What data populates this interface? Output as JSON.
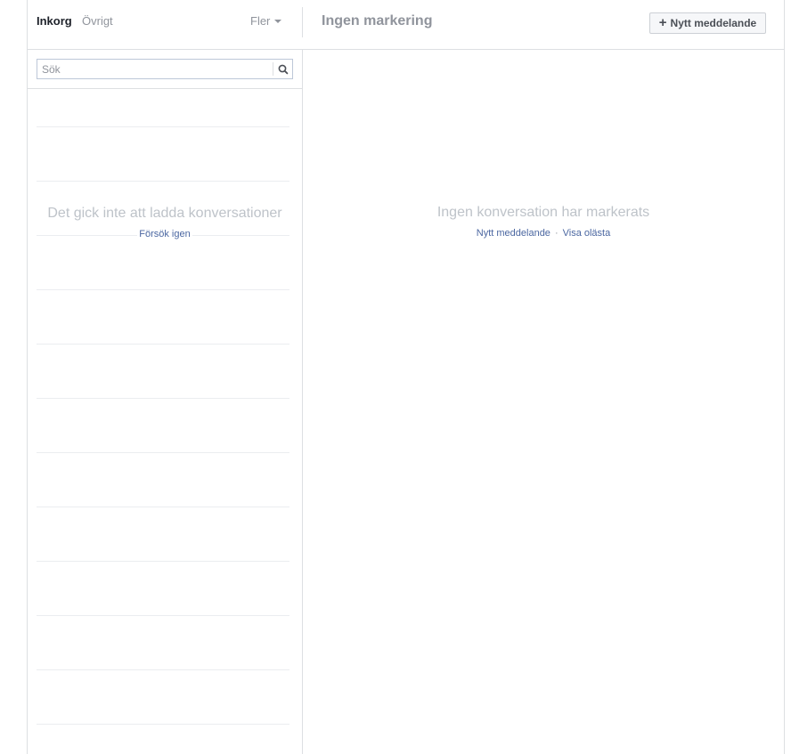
{
  "header": {
    "tabs": [
      {
        "label": "Inkorg",
        "active": true
      },
      {
        "label": "Övrigt",
        "active": false
      }
    ],
    "more_label": "Fler",
    "thread_title": "Ingen markering",
    "new_message_button": {
      "icon": "plus-icon",
      "label": "Nytt meddelande"
    }
  },
  "search": {
    "placeholder": "Sök",
    "value": "",
    "icon": "search-icon"
  },
  "conversation_list": {
    "error_text": "Det gick inte att ladda konversationer",
    "retry_label": "Försök igen"
  },
  "thread_pane": {
    "empty_text": "Ingen konversation har markerats",
    "actions": [
      {
        "label": "Nytt meddelande"
      },
      {
        "label": "Visa olästa"
      }
    ],
    "separator": "·"
  },
  "colors": {
    "link": "#4b67a1",
    "muted_text": "#90949c",
    "empty_state_text": "#bec3c9",
    "border": "#dddfe2",
    "active_tab_text": "#1d2129"
  }
}
